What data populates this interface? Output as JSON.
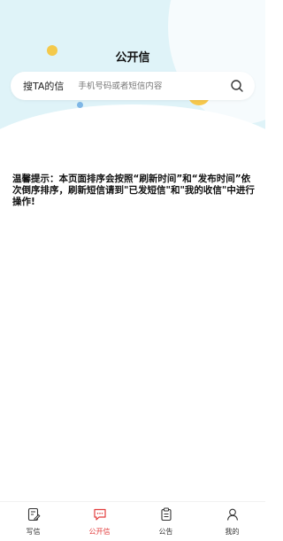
{
  "header": {
    "title": "公开信"
  },
  "search": {
    "label": "搜TA的信",
    "placeholder": "手机号码或者短信内容",
    "icon": "search-icon"
  },
  "notice": {
    "text": "温馨提示：本页面排序会按照“刷新时间”和“发布时间”依次倒序排序，刷新短信请到\"已发短信\"和\"我的收信\"中进行操作!"
  },
  "tabbar": {
    "active_color": "#e23b3b",
    "items": [
      {
        "label": "写信",
        "icon": "write-icon"
      },
      {
        "label": "公开信",
        "icon": "message-icon"
      },
      {
        "label": "公告",
        "icon": "clipboard-icon"
      },
      {
        "label": "我的",
        "icon": "user-icon"
      }
    ]
  }
}
